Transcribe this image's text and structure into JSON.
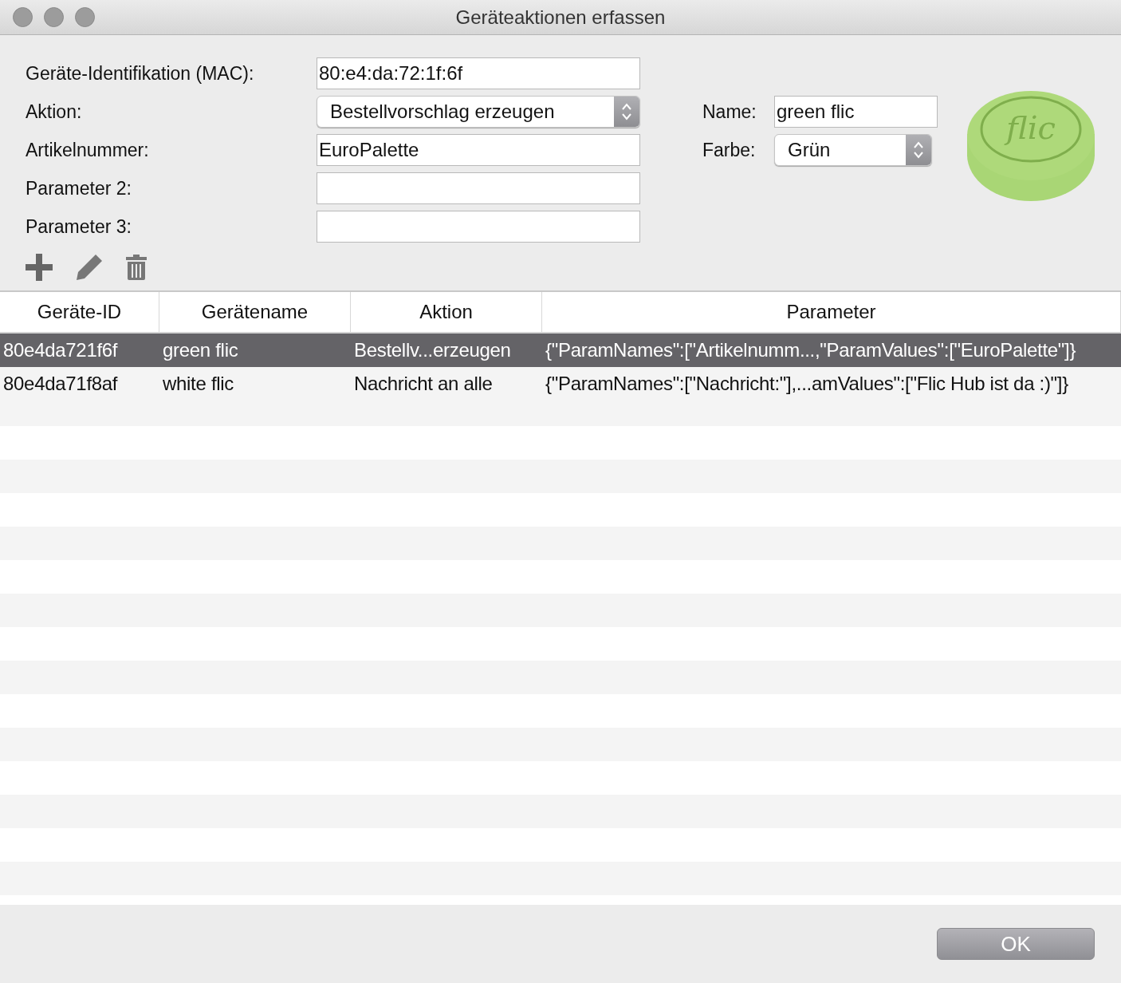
{
  "window": {
    "title": "Geräteaktionen erfassen"
  },
  "form": {
    "fields": [
      {
        "kind": "text",
        "label": "Geräte-Identifikation (MAC):",
        "value": "80:e4:da:72:1f:6f"
      },
      {
        "kind": "select",
        "label": "Aktion:",
        "value": "Bestellvorschlag erzeugen"
      },
      {
        "kind": "text",
        "label": "Artikelnummer:",
        "value": "EuroPalette"
      },
      {
        "kind": "text",
        "label": "Parameter 2:"
      },
      {
        "kind": "text",
        "label": "Parameter 3:"
      }
    ],
    "side_fields": [
      {
        "kind": "text",
        "label": "Name:",
        "value": "green flic"
      },
      {
        "kind": "select",
        "label": "Farbe:",
        "value": "Grün"
      }
    ],
    "logo_text": "flic"
  },
  "table": {
    "columns": [
      "Geräte-ID",
      "Gerätename",
      "Aktion",
      "Parameter"
    ],
    "rows": [
      {
        "selected": true,
        "cells": [
          "80e4da721f6f",
          "green flic",
          "Bestellv...erzeugen",
          "{\"ParamNames\":[\"Artikelnumm...,\"ParamValues\":[\"EuroPalette\"]}"
        ]
      },
      {
        "selected": false,
        "cells": [
          "80e4da71f8af",
          "white flic",
          "Nachricht an alle",
          "{\"ParamNames\":[\"Nachricht:\"],...amValues\":[\"Flic Hub ist da :)\"]}"
        ]
      }
    ]
  },
  "buttons": [
    "OK"
  ]
}
